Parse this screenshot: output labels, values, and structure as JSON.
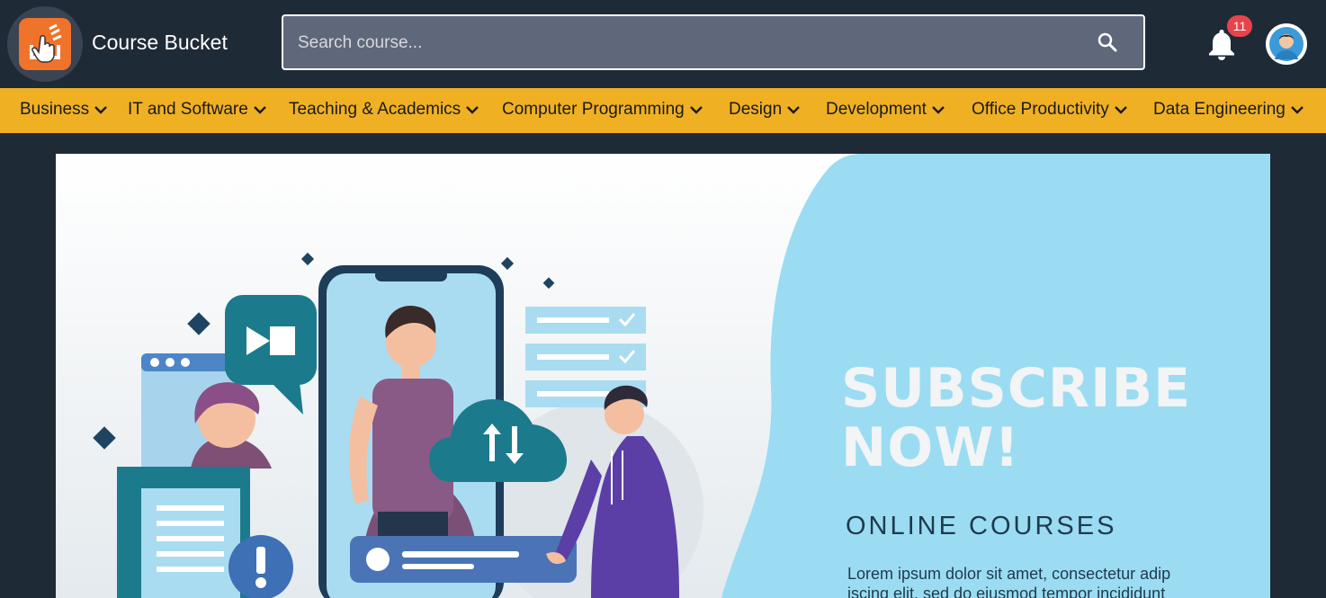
{
  "header": {
    "brand": "Course Bucket",
    "search_placeholder": "Search course...",
    "notification_count": "11"
  },
  "categories": [
    "Business",
    "IT and Software",
    "Teaching & Academics",
    "Computer Programming",
    "Design",
    "Development",
    "Office Productivity",
    "Data Engineering"
  ],
  "banner": {
    "headline_line1": "SUBSCRIBE",
    "headline_line2": "NOW!",
    "subheading": "ONLINE COURSES",
    "body": "Lorem ipsum dolor sit amet, consectetur adip iscing elit, sed do eiusmod tempor incididunt"
  },
  "colors": {
    "header_bg": "#1f2a37",
    "nav_bg": "#f0b024",
    "logo_bg": "#f0732b",
    "badge_bg": "#e8434b",
    "banner_accent": "#9bdcf2",
    "illustration_teal": "#1b7b8c"
  }
}
